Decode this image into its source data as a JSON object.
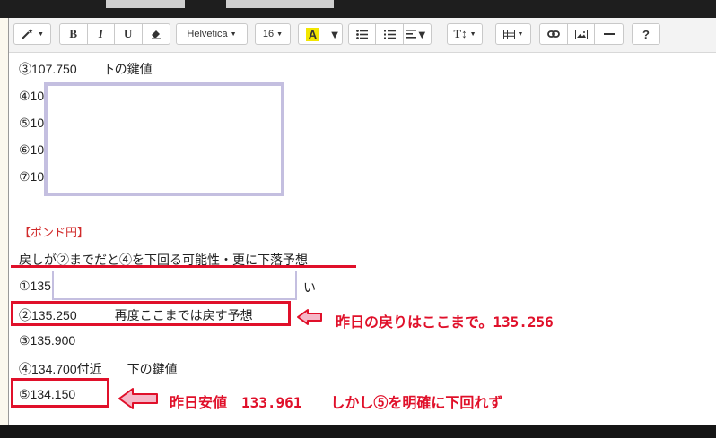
{
  "toolbar": {
    "magic_icon": "magic-wand-icon",
    "bold": "B",
    "italic": "I",
    "underline": "U",
    "font_family": "Helvetica",
    "font_size": "16",
    "highlight_label": "A",
    "highlight_color": "#f2e600",
    "textsize_label": "T↕",
    "help": "?"
  },
  "content": {
    "line_1": "③107.750　　下の鍵値",
    "line_2": "④10",
    "line_3": "⑤10",
    "line_4": "⑥10",
    "line_5": "⑦10",
    "section_title": "【ポンド円】",
    "subtitle": "戻しが②までだと④を下回る可能性・更に下落予想",
    "row_1_prefix": "①135",
    "row_1_suffix": "い",
    "row_2": "②135.250　　　再度ここまでは戻す予想",
    "row_3": "③135.900",
    "row_4": "④134.700付近　　下の鍵値",
    "row_5": "⑤134.150"
  },
  "annotations": {
    "note_1": "昨日の戻りはここまで。135.256",
    "note_2": "昨日安値　133.961　　しかし⑤を明確に下回れず"
  },
  "colors": {
    "annotation": "#e0102a",
    "section_title": "#d12b2b",
    "mask_border": "#c4bfe0"
  }
}
